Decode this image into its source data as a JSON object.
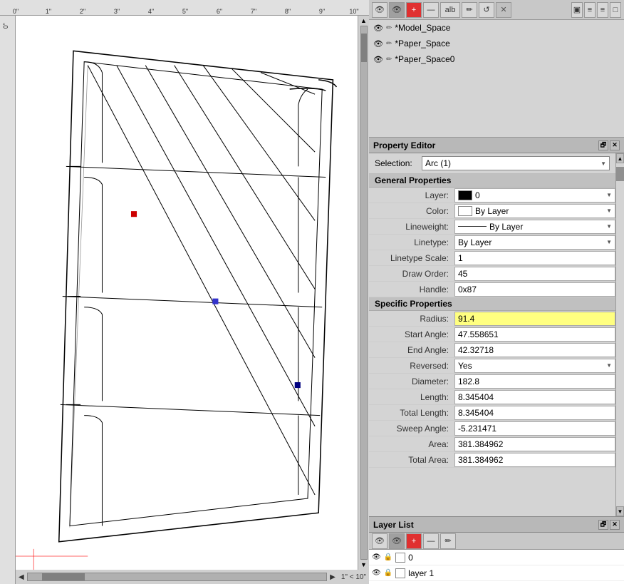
{
  "toolbar": {
    "buttons": [
      "👁",
      "👁",
      "+",
      "—",
      "alb",
      "✏",
      "↺",
      "✕"
    ]
  },
  "layers": [
    {
      "name": "*Model_Space",
      "visible": true,
      "current": true
    },
    {
      "name": "*Paper_Space",
      "visible": true,
      "current": false
    },
    {
      "name": "*Paper_Space0",
      "visible": true,
      "current": false
    }
  ],
  "propertyEditor": {
    "title": "Property Editor",
    "selection": "Arc (1)",
    "generalSection": "General Properties",
    "properties": [
      {
        "label": "Layer:",
        "value": "0",
        "type": "dropdown",
        "hasColor": true,
        "colorHex": "#000000"
      },
      {
        "label": "Color:",
        "value": "By Layer",
        "type": "dropdown",
        "hasColor": true,
        "colorHex": "#ffffff"
      },
      {
        "label": "Lineweight:",
        "value": "By Layer",
        "type": "dropdown",
        "hasLine": true
      },
      {
        "label": "Linetype:",
        "value": "By Layer",
        "type": "dropdown"
      },
      {
        "label": "Linetype Scale:",
        "value": "1",
        "type": "text"
      },
      {
        "label": "Draw Order:",
        "value": "45",
        "type": "text"
      },
      {
        "label": "Handle:",
        "value": "0x87",
        "type": "text"
      }
    ],
    "specificSection": "Specific Properties",
    "specificProperties": [
      {
        "label": "Radius:",
        "value": "91.4",
        "type": "text",
        "highlighted": true
      },
      {
        "label": "Start Angle:",
        "value": "47.558651",
        "type": "text"
      },
      {
        "label": "End Angle:",
        "value": "42.32718",
        "type": "text"
      },
      {
        "label": "Reversed:",
        "value": "Yes",
        "type": "dropdown"
      },
      {
        "label": "Diameter:",
        "value": "182.8",
        "type": "text"
      },
      {
        "label": "Length:",
        "value": "8.345404",
        "type": "text"
      },
      {
        "label": "Total Length:",
        "value": "8.345404",
        "type": "text"
      },
      {
        "label": "Sweep Angle:",
        "value": "-5.231471",
        "type": "text"
      },
      {
        "label": "Area:",
        "value": "381.384962",
        "type": "text"
      },
      {
        "label": "Total Area:",
        "value": "381.384962",
        "type": "text"
      }
    ]
  },
  "layerList": {
    "title": "Layer List",
    "layers": [
      {
        "name": "0",
        "visible": true,
        "locked": false,
        "colorHex": "#ffffff"
      },
      {
        "name": "layer 1",
        "visible": true,
        "locked": false,
        "colorHex": "#ffffff"
      }
    ]
  },
  "ruler": {
    "marks": [
      "0\"",
      "1\"",
      "2\"",
      "3\"",
      "4\"",
      "5\"",
      "6\"",
      "7\"",
      "8\"",
      "9\"",
      "10\""
    ],
    "scale": "1\" < 10\""
  },
  "icons": {
    "eye": "👁",
    "pencil": "✏",
    "lock": "🔒",
    "plus": "+",
    "minus": "−",
    "close": "✕",
    "restore": "🗗",
    "expand": "▲",
    "collapse": "▼"
  }
}
